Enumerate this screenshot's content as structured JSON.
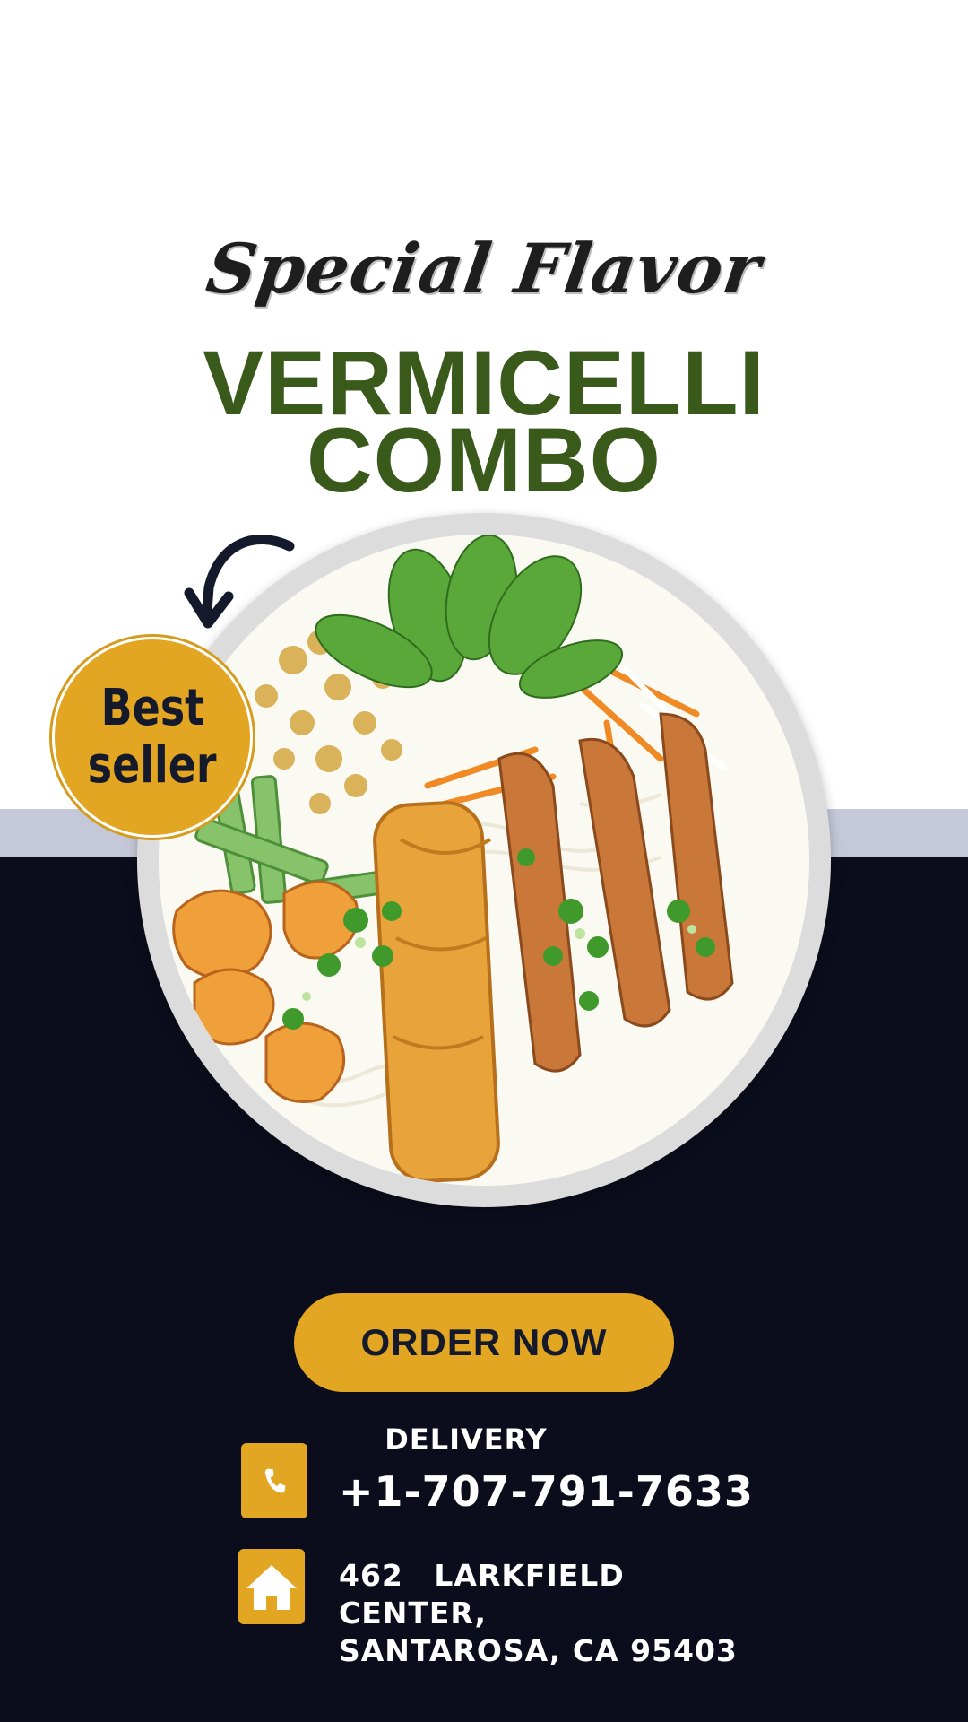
{
  "header": {
    "subtitle": "Special Flavor",
    "title_line1": "VERMICELLI",
    "title_line2": "COMBO"
  },
  "badge": {
    "line1": "Best",
    "line2": "seller"
  },
  "order_button": {
    "label": "ORDER NOW"
  },
  "contact": {
    "delivery_label": "DELIVERY",
    "phone": "+1-707-791-7633",
    "address_line1": "462 LARKFIELD CENTER,",
    "address_line2": "SANTAROSA, CA 95403"
  },
  "icons": {
    "arrow": "curved-arrow-icon",
    "phone": "phone-icon",
    "home": "home-icon"
  },
  "colors": {
    "title_green": "#3a5a1b",
    "accent_gold": "#e3a623",
    "dark_navy": "#0b0d1c",
    "band_lavender": "#c5c8d8"
  }
}
